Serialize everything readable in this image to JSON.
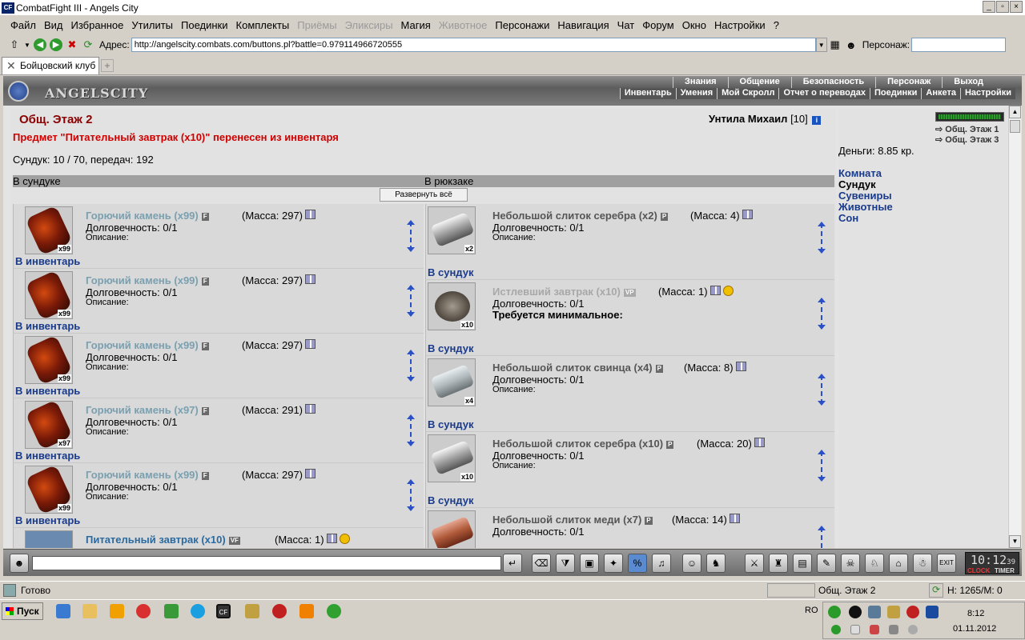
{
  "window": {
    "title": "CombatFight III - Angels City",
    "logo_text": "CF"
  },
  "menu": [
    {
      "label": "Файл",
      "enabled": true
    },
    {
      "label": "Вид",
      "enabled": true
    },
    {
      "label": "Избранное",
      "enabled": true
    },
    {
      "label": "Утилиты",
      "enabled": true
    },
    {
      "label": "Поединки",
      "enabled": true
    },
    {
      "label": "Комплекты",
      "enabled": true
    },
    {
      "label": "Приёмы",
      "enabled": false
    },
    {
      "label": "Эликсиры",
      "enabled": false
    },
    {
      "label": "Магия",
      "enabled": true
    },
    {
      "label": "Животное",
      "enabled": false
    },
    {
      "label": "Персонажи",
      "enabled": true
    },
    {
      "label": "Навигация",
      "enabled": true
    },
    {
      "label": "Чат",
      "enabled": true
    },
    {
      "label": "Форум",
      "enabled": true
    },
    {
      "label": "Окно",
      "enabled": true
    },
    {
      "label": "Настройки",
      "enabled": true
    },
    {
      "label": "?",
      "enabled": true
    }
  ],
  "address": {
    "label": "Адрес:",
    "url": "http://angelscity.combats.com/buttons.pl?battle=0.979114966720555",
    "persona_label": "Персонаж:",
    "persona_value": ""
  },
  "tabs": [
    {
      "label": "Бойцовский клуб"
    }
  ],
  "game": {
    "brand": "ANGELSCITY",
    "nav_top": [
      "Знания",
      "Общение",
      "Безопасность",
      "Персонаж",
      "Выход"
    ],
    "nav_bottom": [
      "Инвентарь",
      "Умения",
      "Мой Скролл",
      "Отчет о переводах",
      "Поединки",
      "Анкета",
      "Настройки"
    ],
    "room": "Общ. Этаж 2",
    "player": {
      "name": "Унтила Михаил",
      "level": "[10]",
      "info_icon": "i"
    },
    "message": "Предмет \"Питательный завтрак (x10)\" перенесен из инвентаря",
    "chest_info": "Сундук: 10 / 70, передач: 192",
    "chest_header": "В сундуке",
    "backpack_header": "В рюкзаке",
    "expand_all": "Развернуть всё",
    "chest_items": [
      {
        "name": "Горючий камень (x99)",
        "badge": "F",
        "mass": "(Масса: 297)",
        "durability": "Долговечность: 0/1",
        "desc": "Описание:",
        "count": "x99",
        "action": "В инвентарь",
        "icon": "fire-stone"
      },
      {
        "name": "Горючий камень (x99)",
        "badge": "F",
        "mass": "(Масса: 297)",
        "durability": "Долговечность: 0/1",
        "desc": "Описание:",
        "count": "x99",
        "action": "В инвентарь",
        "icon": "fire-stone"
      },
      {
        "name": "Горючий камень (x99)",
        "badge": "F",
        "mass": "(Масса: 297)",
        "durability": "Долговечность: 0/1",
        "desc": "Описание:",
        "count": "x99",
        "action": "В инвентарь",
        "icon": "fire-stone"
      },
      {
        "name": "Горючий камень (x97)",
        "badge": "F",
        "mass": "(Масса: 291)",
        "durability": "Долговечность: 0/1",
        "desc": "Описание:",
        "count": "x97",
        "action": "В инвентарь",
        "icon": "fire-stone"
      },
      {
        "name": "Горючий камень (x99)",
        "badge": "F",
        "mass": "(Масса: 297)",
        "durability": "Долговечность: 0/1",
        "desc": "Описание:",
        "count": "x99",
        "action": "В инвентарь",
        "icon": "fire-stone"
      },
      {
        "name": "Питательный завтрак (x10)",
        "badge": "VF",
        "mass": "(Масса: 1)",
        "durability": "",
        "desc": "",
        "count": "",
        "action": "",
        "icon": "food"
      }
    ],
    "backpack_items": [
      {
        "name": "Небольшой слиток серебра (x2)",
        "badge": "P",
        "mass": "(Масса: 4)",
        "durability": "Долговечность: 0/1",
        "desc": "Описание:",
        "count": "x2",
        "action": "В сундук",
        "icon": "silver-bar",
        "gray": false
      },
      {
        "name": "Истлевший завтрак (x10)",
        "badge": "VP",
        "mass": "(Масса: 1)",
        "durability": "Долговечность: 0/1",
        "req": "Требуется минимальное:",
        "count": "x10",
        "action": "В сундук",
        "icon": "food",
        "gray": true
      },
      {
        "name": "Небольшой слиток свинца (x4)",
        "badge": "P",
        "mass": "(Масса: 8)",
        "durability": "Долговечность: 0/1",
        "desc": "Описание:",
        "count": "x4",
        "action": "В сундук",
        "icon": "lead-bar",
        "gray": false
      },
      {
        "name": "Небольшой слиток серебра (x10)",
        "badge": "P",
        "mass": "(Масса: 20)",
        "durability": "Долговечность: 0/1",
        "desc": "Описание:",
        "count": "x10",
        "action": "В сундук",
        "icon": "silver-bar",
        "gray": false
      },
      {
        "name": "Небольшой слиток меди (x7)",
        "badge": "P",
        "mass": "(Масса: 14)",
        "durability": "Долговечность: 0/1",
        "desc": "",
        "count": "",
        "action": "",
        "icon": "copper-bar",
        "gray": false
      }
    ],
    "side": {
      "locations": [
        "Общ. Этаж 1",
        "Общ. Этаж 3"
      ],
      "money": "Деньги: 8.85 кр.",
      "menu": [
        {
          "label": "Комната",
          "current": false
        },
        {
          "label": "Сундук",
          "current": true
        },
        {
          "label": "Сувениры",
          "current": false
        },
        {
          "label": "Животные",
          "current": false
        },
        {
          "label": "Сон",
          "current": false
        }
      ]
    }
  },
  "chat": {
    "input": "",
    "clock": "10:12",
    "clock_sec": "39",
    "clock_label": "CLOCK",
    "timer_label": "TIMER",
    "exit": "EXIT"
  },
  "status": {
    "text": "Готово",
    "location": "Общ. Этаж 2",
    "hp": "Н: 1265/М: 0"
  },
  "taskbar": {
    "start": "Пуск",
    "lang": "RO",
    "time": "8:12",
    "date": "01.11.2012",
    "active_app": "CF"
  }
}
